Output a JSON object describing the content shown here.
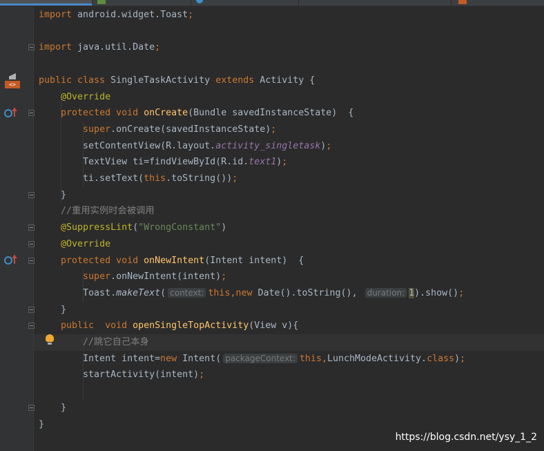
{
  "colors": {
    "background": "#2b2b2b",
    "gutter": "#313335",
    "keyword": "#cc7832",
    "text": "#a9b7c6",
    "annotation": "#bbb529",
    "string": "#6a8759",
    "comment": "#808080",
    "field": "#9876aa",
    "method": "#ffc66d",
    "hint": "#787878"
  },
  "current_line": 20,
  "code": [
    [
      [
        "kw",
        "import"
      ],
      [
        "t",
        " android.widget.Toast"
      ],
      [
        "kw",
        ";"
      ]
    ],
    [],
    [
      [
        "kw",
        "import"
      ],
      [
        "t",
        " java.util.Date"
      ],
      [
        "kw",
        ";"
      ]
    ],
    [],
    [
      [
        "kw",
        "public class"
      ],
      [
        "t",
        " SingleTaskActivity "
      ],
      [
        "kw",
        "extends"
      ],
      [
        "t",
        " Activity {"
      ]
    ],
    [
      [
        "t",
        "    "
      ],
      [
        "an",
        "@Override"
      ]
    ],
    [
      [
        "t",
        "    "
      ],
      [
        "kw",
        "protected void"
      ],
      [
        "t",
        " "
      ],
      [
        "md",
        "onCreate"
      ],
      [
        "t",
        "(Bundle savedInstanceState)  {"
      ]
    ],
    [
      [
        "t",
        "        "
      ],
      [
        "kw",
        "super"
      ],
      [
        "t",
        ".onCreate(savedInstanceState)"
      ],
      [
        "kw",
        ";"
      ]
    ],
    [
      [
        "t",
        "        setContentView(R.layout."
      ],
      [
        "fd",
        "activity_singletask"
      ],
      [
        "t",
        ")"
      ],
      [
        "kw",
        ";"
      ]
    ],
    [
      [
        "t",
        "        TextView ti=findViewById(R.id."
      ],
      [
        "fd",
        "text1"
      ],
      [
        "t",
        ")"
      ],
      [
        "kw",
        ";"
      ]
    ],
    [
      [
        "t",
        "        ti.setText("
      ],
      [
        "kw",
        "this"
      ],
      [
        "t",
        ".toString())"
      ],
      [
        "kw",
        ";"
      ]
    ],
    [
      [
        "t",
        "    }"
      ]
    ],
    [
      [
        "t",
        "    "
      ],
      [
        "cm",
        "//重用实例时会被调用"
      ]
    ],
    [
      [
        "t",
        "    "
      ],
      [
        "an",
        "@SuppressLint"
      ],
      [
        "t",
        "("
      ],
      [
        "st",
        "\"WrongConstant\""
      ],
      [
        "t",
        ")"
      ]
    ],
    [
      [
        "t",
        "    "
      ],
      [
        "an",
        "@Override"
      ]
    ],
    [
      [
        "t",
        "    "
      ],
      [
        "kw",
        "protected void"
      ],
      [
        "t",
        " "
      ],
      [
        "md",
        "onNewIntent"
      ],
      [
        "t",
        "(Intent intent)  {"
      ]
    ],
    [
      [
        "t",
        "        "
      ],
      [
        "kw",
        "super"
      ],
      [
        "t",
        ".onNewIntent(intent)"
      ],
      [
        "kw",
        ";"
      ]
    ],
    [
      [
        "t",
        "        Toast."
      ],
      [
        "it",
        "makeText"
      ],
      [
        "t",
        "("
      ],
      [
        "hint",
        "context:"
      ],
      [
        "kw",
        "this,new"
      ],
      [
        "t",
        " Date().toString(), "
      ],
      [
        "hint",
        "duration:"
      ],
      [
        "caret",
        "1"
      ],
      [
        "t",
        ").show()"
      ],
      [
        "kw",
        ";"
      ]
    ],
    [
      [
        "t",
        "    }"
      ]
    ],
    [
      [
        "t",
        "    "
      ],
      [
        "kw",
        "public  void"
      ],
      [
        "t",
        " "
      ],
      [
        "md",
        "openSingleTopActivity"
      ],
      [
        "t",
        "(View v){"
      ]
    ],
    [
      [
        "t",
        "        "
      ],
      [
        "cm",
        "//跳它自己本身"
      ]
    ],
    [
      [
        "t",
        "        Intent intent="
      ],
      [
        "kw",
        "new"
      ],
      [
        "t",
        " Intent("
      ],
      [
        "hint",
        "packageContext:"
      ],
      [
        "kw",
        "this,"
      ],
      [
        "t",
        "LunchModeActivity."
      ],
      [
        "kw",
        "class"
      ],
      [
        "t",
        ")"
      ],
      [
        "kw",
        ";"
      ]
    ],
    [
      [
        "t",
        "        startActivity(intent)"
      ],
      [
        "kw",
        ";"
      ]
    ],
    [],
    [
      [
        "t",
        "    }"
      ]
    ],
    [
      [
        "t",
        "}"
      ]
    ]
  ],
  "watermark": "https://blog.csdn.net/ysy_1_2"
}
